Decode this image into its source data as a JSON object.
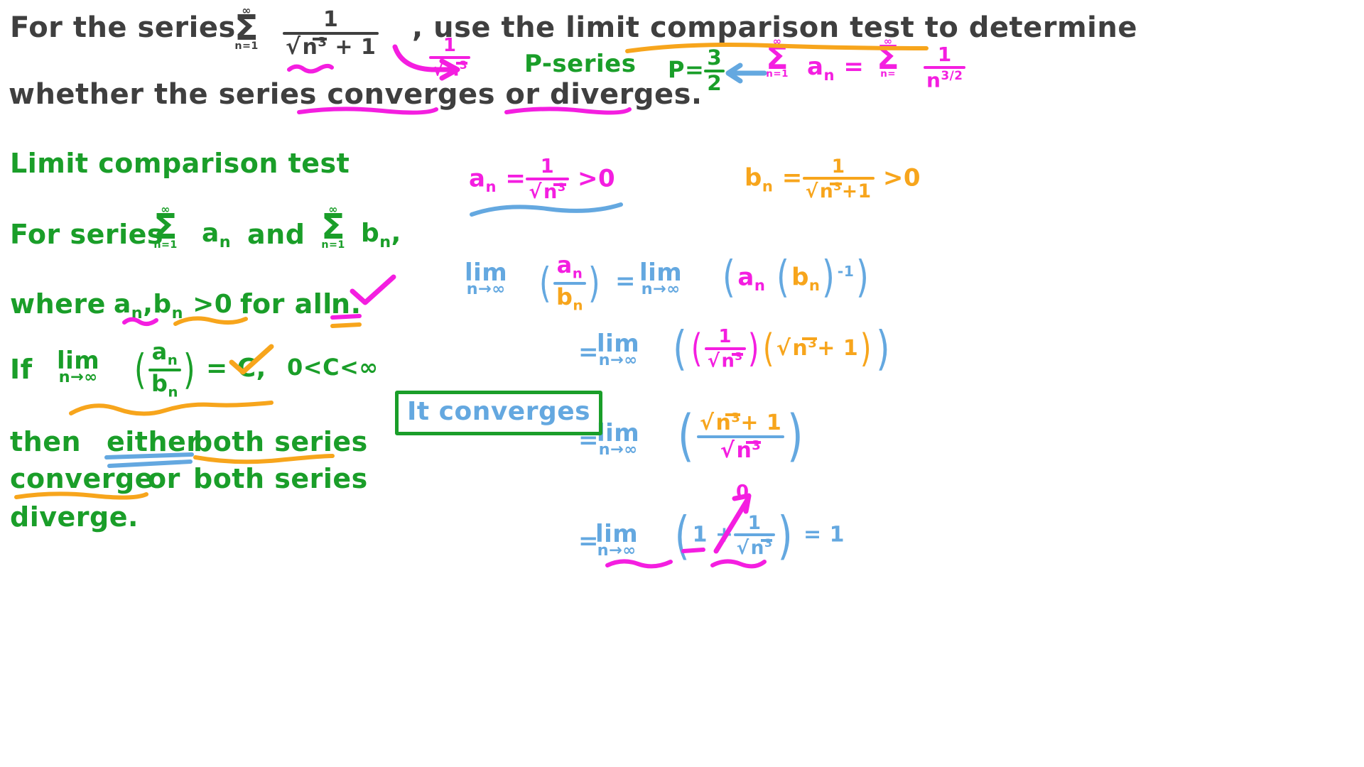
{
  "colors": {
    "ink_dark": "#3f3f3f",
    "green": "#1a9e29",
    "magenta": "#f41ee0",
    "orange": "#f7a51c",
    "blue": "#64a8e0",
    "background": "#ffffff"
  },
  "problem": {
    "line1_part1": "For the series",
    "series_sum_top": "∞",
    "series_sum_sign": "Σ",
    "series_sum_bottom": "n=1",
    "series_numerator": "1",
    "series_denominator_root": "n",
    "series_denominator_exp": "3",
    "series_denominator_tail": "+ 1",
    "line1_part2": ", use the limit comparison test to determine",
    "line2": "whether the series converges or diverges."
  },
  "annotations": {
    "comparison_term_num": "1",
    "comparison_term_root": "n",
    "comparison_term_exp": "3",
    "p_series_label": "P-series",
    "p_value_label": "P=",
    "p_value_num": "3",
    "p_value_den": "2",
    "sum_an_top": "∞",
    "sum_an_sign": "Σ",
    "sum_an_bottom": "n=1",
    "sum_an_term": "a",
    "sum_an_sub": "n",
    "equals": "=",
    "sum_rhs_top": "∞",
    "sum_rhs_sign": "Σ",
    "sum_rhs_bottom": "n=",
    "sum_rhs_num": "1",
    "sum_rhs_den_base": "n",
    "sum_rhs_den_exp": "3/2"
  },
  "theorem": {
    "title": "Limit comparison test",
    "line_for_series": "For series",
    "sum1_top": "∞",
    "sum1_sign": "Σ",
    "sum1_bottom": "n=1",
    "sum1_term": "a",
    "sum1_sub": "n",
    "and": "and",
    "sum2_top": "∞",
    "sum2_sign": "Σ",
    "sum2_bottom": "n=1",
    "sum2_term": "b",
    "sum2_sub": "n",
    "comma": ",",
    "where_text": "where",
    "where_an": "a",
    "where_an_sub": "n",
    "where_sep": ",",
    "where_bn": "b",
    "where_bn_sub": "n",
    "where_gt": ">0",
    "where_forall": "for all",
    "where_n": "n",
    "where_period": ".",
    "if_text": "If",
    "if_lim_word": "lim",
    "if_lim_sub": "n→∞",
    "if_num": "a",
    "if_num_sub": "n",
    "if_den": "b",
    "if_den_sub": "n",
    "if_equals": "= C",
    "if_comma": ",",
    "c_range": "0<C<∞",
    "concl_line1_a": "then",
    "concl_line1_b": "either",
    "concl_line1_c": "both series",
    "concl_line2_a": "converge",
    "concl_line2_b": "or",
    "concl_line2_c": "both series",
    "concl_line3": "diverge."
  },
  "work": {
    "an_label": "a",
    "an_sub": "n",
    "an_eq": "=",
    "an_num": "1",
    "an_root": "n",
    "an_exp": "3",
    "an_gt": ">0",
    "bn_label": "b",
    "bn_sub": "n",
    "bn_eq": "=",
    "bn_num": "1",
    "bn_root": "n",
    "bn_exp": "3",
    "bn_tail": "+1",
    "bn_gt": ">0",
    "step1_lim": "lim",
    "step1_lim_sub": "n→∞",
    "step1_num": "a",
    "step1_num_sub": "n",
    "step1_den": "b",
    "step1_den_sub": "n",
    "step1_eq": "=",
    "step1_rhs_lim": "lim",
    "step1_rhs_lim_sub": "n→∞",
    "step1_rhs_a": "a",
    "step1_rhs_a_sub": "n",
    "step1_rhs_b": "b",
    "step1_rhs_b_sub": "n",
    "step1_rhs_pow": "-1",
    "step2_eq": "=",
    "step2_lim": "lim",
    "step2_lim_sub": "n→∞",
    "step2_num": "1",
    "step2_root": "n",
    "step2_exp": "3",
    "step2_second_root": "n",
    "step2_second_exp": "3",
    "step2_second_tail": "+ 1",
    "step3_eq": "=",
    "step3_lim": "lim",
    "step3_lim_sub": "n→∞",
    "step3_num_root": "n",
    "step3_num_exp": "3",
    "step3_num_tail": "+ 1",
    "step3_den_root": "n",
    "step3_den_exp": "3",
    "step4_eq": "=",
    "step4_lim": "lim",
    "step4_lim_sub": "n→∞",
    "step4_one": "1",
    "step4_plus": "+",
    "step4_frac_num": "1",
    "step4_frac_root": "n",
    "step4_frac_exp": "3",
    "step4_result": "= 1",
    "step4_arrow_target": "0",
    "answer": "It converges"
  }
}
